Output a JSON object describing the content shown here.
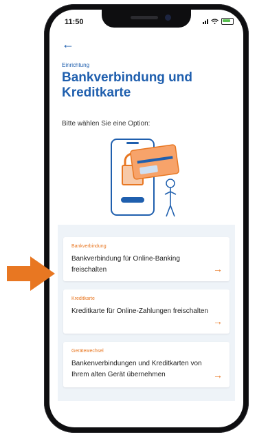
{
  "status": {
    "time": "11:50"
  },
  "header": {
    "back_icon": "arrow-left-icon",
    "overline": "Einrichtung",
    "title": "Bankverbindung und Kreditkarte"
  },
  "prompt": "Bitte wählen Sie eine Option:",
  "options": [
    {
      "label": "Bankverbindung",
      "description": "Bankverbindung für Online-Banking freischalten",
      "icon": "arrow-right-icon"
    },
    {
      "label": "Kreditkarte",
      "description": "Kreditkarte für Online-Zahlungen freischalten",
      "icon": "arrow-right-icon"
    },
    {
      "label": "Gerätewechsel",
      "description": "Bankenverbindungen und Kreditkarten von Ihrem alten Gerät übernehmen",
      "icon": "arrow-right-icon"
    }
  ],
  "colors": {
    "primary": "#1f5fae",
    "accent": "#e87722",
    "panel": "#eef3f8"
  },
  "annotation": {
    "icon": "orange-arrow-icon"
  }
}
